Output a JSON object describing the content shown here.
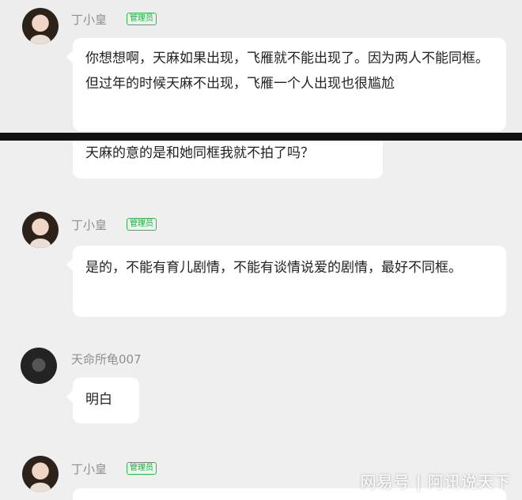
{
  "messages": [
    {
      "name": "丁小皇",
      "badge": "管理员",
      "text": "你想想啊，天麻如果出现，飞雁就不能出现了。因为两人不能同框。但过年的时候天麻不出现，飞雁一个人出现也很尴尬"
    },
    {
      "text": "天麻的意的是和她同框我就不拍了吗？"
    },
    {
      "name": "丁小皇",
      "badge": "管理员",
      "text": "是的，不能有育儿剧情，不能有谈情说爱的剧情，最好不同框。"
    },
    {
      "name": "天命所龟007",
      "text": "明白"
    },
    {
      "name": "丁小皇",
      "badge": "管理员"
    }
  ],
  "watermark": "网易号 | 阿讯说天下"
}
